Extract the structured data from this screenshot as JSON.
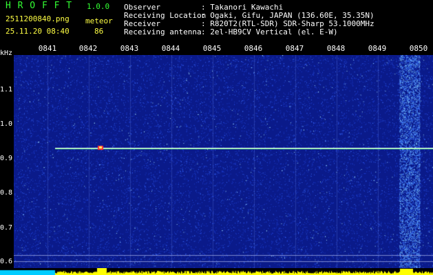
{
  "app": {
    "logo": "H R O F F T",
    "version": "1.0.0",
    "filename": "2511200840.png",
    "datetime": "25.11.20 08:40",
    "mode_label": "meteor",
    "count": "86"
  },
  "info": {
    "observer_key": "Observer",
    "observer_value": ": Takanori Kawachi",
    "location_key": "Receiving Location",
    "location_value": ": Ogaki, Gifu, JAPAN (136.60E, 35.35N)",
    "receiver_key": "Receiver",
    "receiver_value": ": R820T2(RTL-SDR) SDR-Sharp 53.1000MHz",
    "antenna_key": "Receiving antenna",
    "antenna_value": ": 2el-HB9CV Vertical (el. E-W)"
  },
  "axis": {
    "unit": "kHz",
    "y_labels": [
      "1.1",
      "1.0",
      "0.9",
      "0.8",
      "0.7",
      "0.6"
    ],
    "minutes": [
      "0841",
      "0842",
      "0843",
      "0844",
      "0845",
      "0846",
      "0847",
      "0848",
      "0849",
      "0850"
    ]
  },
  "colors": {
    "background": "#0a1a8a",
    "signal_line": "#ffffff",
    "burst": "#ff3030",
    "bottom_bar": "#ffff00",
    "bottom_left": "#00ccff"
  }
}
